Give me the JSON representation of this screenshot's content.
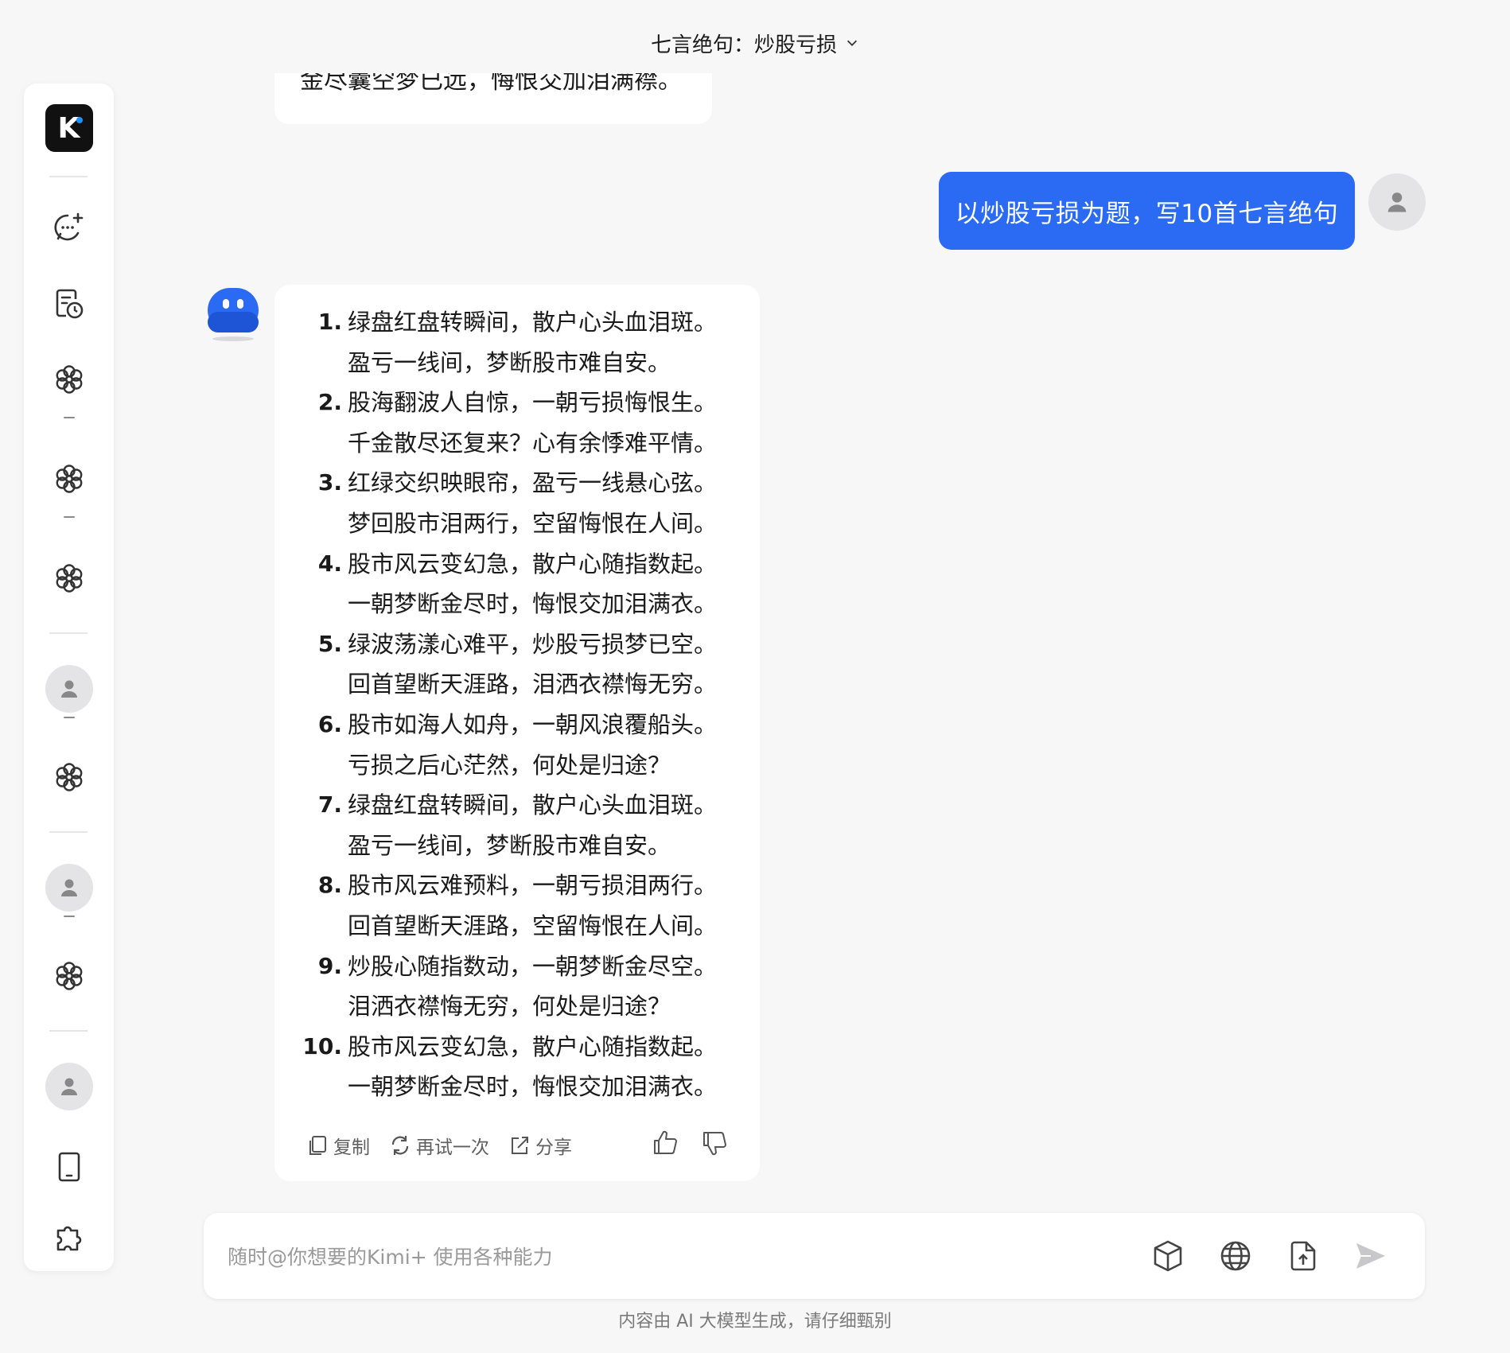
{
  "header": {
    "title": "七言绝句：炒股亏损"
  },
  "previous_message": {
    "text": "金尽囊空梦已远，悔恨交加泪满襟。"
  },
  "user_message": {
    "text": "以炒股亏损为题，写10首七言绝句"
  },
  "bot_message": {
    "poems": [
      {
        "num": "1.",
        "l1": "绿盘红盘转瞬间，散户心头血泪斑。",
        "l2": "盈亏一线间，梦断股市难自安。"
      },
      {
        "num": "2.",
        "l1": "股海翻波人自惊，一朝亏损悔恨生。",
        "l2": "千金散尽还复来？心有余悸难平情。"
      },
      {
        "num": "3.",
        "l1": "红绿交织映眼帘，盈亏一线悬心弦。",
        "l2": "梦回股市泪两行，空留悔恨在人间。"
      },
      {
        "num": "4.",
        "l1": "股市风云变幻急，散户心随指数起。",
        "l2": "一朝梦断金尽时，悔恨交加泪满衣。"
      },
      {
        "num": "5.",
        "l1": "绿波荡漾心难平，炒股亏损梦已空。",
        "l2": "回首望断天涯路，泪洒衣襟悔无穷。"
      },
      {
        "num": "6.",
        "l1": "股市如海人如舟，一朝风浪覆船头。",
        "l2": "亏损之后心茫然，何处是归途？"
      },
      {
        "num": "7.",
        "l1": "绿盘红盘转瞬间，散户心头血泪斑。",
        "l2": "盈亏一线间，梦断股市难自安。"
      },
      {
        "num": "8.",
        "l1": "股市风云难预料，一朝亏损泪两行。",
        "l2": "回首望断天涯路，空留悔恨在人间。"
      },
      {
        "num": "9.",
        "l1": "炒股心随指数动，一朝梦断金尽空。",
        "l2": "泪洒衣襟悔无穷，何处是归途？"
      },
      {
        "num": "10.",
        "l1": "股市风云变幻急，散户心随指数起。",
        "l2": "一朝梦断金尽时，悔恨交加泪满衣。"
      }
    ],
    "actions": {
      "copy": "复制",
      "retry": "再试一次",
      "share": "分享"
    }
  },
  "input": {
    "placeholder": "随时@你想要的Kimi+ 使用各种能力"
  },
  "footer": {
    "text": "内容由 AI 大模型生成，请仔细甄别"
  },
  "sidebar": {
    "logo": "K"
  },
  "colors": {
    "accent": "#2b6af2",
    "background": "#f7f7f8"
  }
}
